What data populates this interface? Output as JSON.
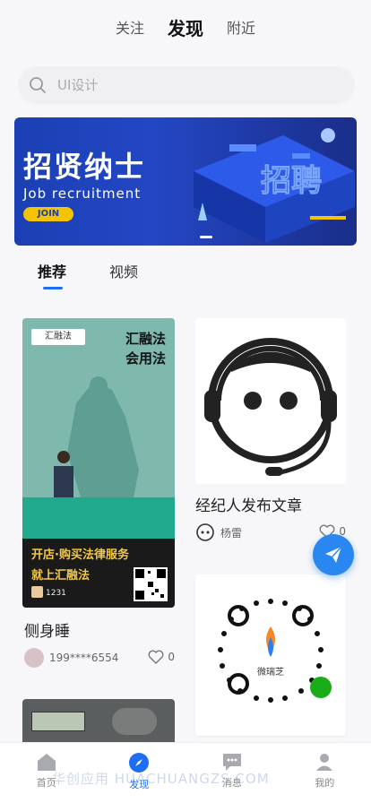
{
  "top_tabs": [
    {
      "label": "关注",
      "active": false
    },
    {
      "label": "发现",
      "active": true
    },
    {
      "label": "附近",
      "active": false
    }
  ],
  "search": {
    "placeholder": "UI设计",
    "icon": "search-icon"
  },
  "banner": {
    "title": "招贤纳士",
    "subtitle": "Job recruitment",
    "button": "JOIN",
    "art_text": "招聘"
  },
  "content_tabs": [
    {
      "label": "推荐",
      "active": true
    },
    {
      "label": "视频",
      "active": false
    }
  ],
  "feed": [
    {
      "poster": {
        "logo": "汇融法",
        "heading_line1": "汇融法",
        "heading_line2": "会用法",
        "line1": "开店·购买法律服务",
        "line2": "就上汇融法",
        "code": "1231"
      },
      "title": "侧身睡",
      "author": "199****6554",
      "likes": "0"
    },
    {
      "title": "经纪人发布文章",
      "author": "杨雷",
      "likes": "0"
    },
    {
      "qr_label": "微瑞芝"
    }
  ],
  "bottom_nav": [
    {
      "label": "首页",
      "icon": "home-icon",
      "active": false
    },
    {
      "label": "发现",
      "icon": "compass-icon",
      "active": true
    },
    {
      "label": "消息",
      "icon": "message-icon",
      "active": false
    },
    {
      "label": "我的",
      "icon": "profile-icon",
      "active": false
    }
  ],
  "watermark": "华创应用 HUACHUANGZS.COM",
  "colors": {
    "accent": "#1e6ef5",
    "fab": "#2a86f0",
    "banner": "#1b3fb3"
  }
}
